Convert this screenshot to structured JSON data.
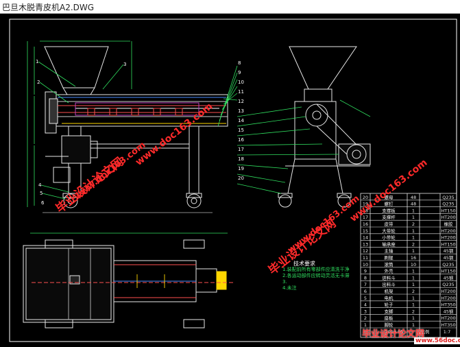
{
  "window": {
    "title": "巴旦木脱青皮机A2.DWG"
  },
  "watermarks": [
    "毕业设计论文网",
    "www.doc163.com",
    "www.doc163.com",
    "毕业设计论文网",
    "www.doc163.com",
    "www.doc163.com",
    "毕业设计论文网",
    "www.56doc.com"
  ],
  "tech_requirements": {
    "title": "技术要求",
    "lines": [
      "1.装配前所有零部件应清洗干净",
      "2.各运动部件应转动灵活无卡滞",
      "3.",
      "4.未注"
    ]
  },
  "bom": {
    "rows": [
      [
        "20",
        "螺母",
        "48",
        "Q235"
      ],
      [
        "19",
        "螺钉",
        "48",
        "Q235"
      ],
      [
        "18",
        "支撑板",
        "1",
        "HT150"
      ],
      [
        "17",
        "支撑杆",
        "1",
        "HT200"
      ],
      [
        "16",
        "皮带",
        "2",
        "橡胶"
      ],
      [
        "15",
        "大带轮",
        "1",
        "HT200"
      ],
      [
        "14",
        "小带轮",
        "1",
        "HT200"
      ],
      [
        "13",
        "轴承座",
        "2",
        "HT150"
      ],
      [
        "12",
        "主轴",
        "1",
        "45钢"
      ],
      [
        "11",
        "刷辊",
        "16",
        "45钢"
      ],
      [
        "10",
        "滚筒",
        "10",
        "Q235"
      ],
      [
        "9",
        "外壳",
        "1",
        "HT150"
      ],
      [
        "8",
        "进料斗",
        "1",
        "45钢"
      ],
      [
        "7",
        "出料斗",
        "1",
        "Q235"
      ],
      [
        "6",
        "机架",
        "2",
        "HT200"
      ],
      [
        "5",
        "电机",
        "1",
        "HT200"
      ],
      [
        "4",
        "轮子",
        "1",
        "HT350"
      ],
      [
        "3",
        "支脚",
        "2",
        "45钢"
      ],
      [
        "2",
        "座板",
        "1",
        "HT200"
      ],
      [
        "1",
        "脚轮",
        "1",
        "HT350"
      ]
    ],
    "footer": [
      "2016.05",
      "比例",
      "1:7"
    ]
  },
  "labels": {
    "left_numbers": [
      "1",
      "2",
      "3",
      "4",
      "5",
      "6"
    ],
    "right_numbers": [
      "8",
      "9",
      "10",
      "11",
      "12",
      "13",
      "14",
      "15",
      "16",
      "17",
      "18",
      "19",
      "20"
    ]
  }
}
